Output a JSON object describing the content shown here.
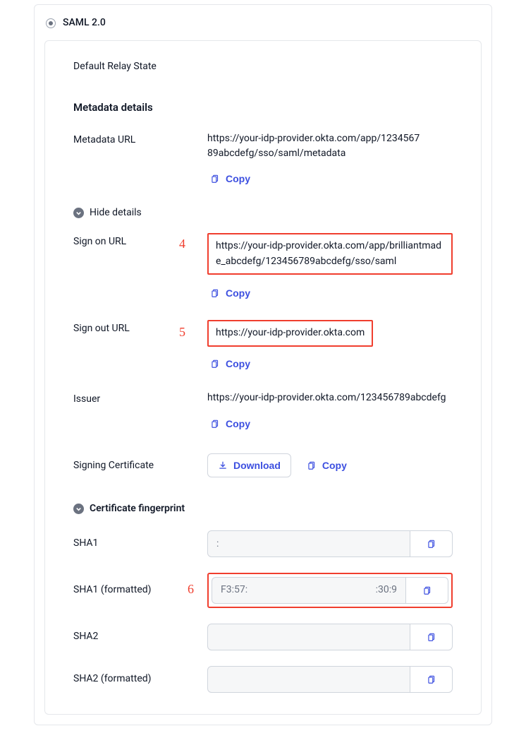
{
  "radio": {
    "label": "SAML 2.0"
  },
  "relay": {
    "label": "Default Relay State"
  },
  "headings": {
    "metadata": "Metadata details",
    "cert_fp": "Certificate fingerprint"
  },
  "fields": {
    "metadata_url": {
      "label": "Metadata URL",
      "value": "https://your-idp-provider.okta.com/app/123456789abcdefg/sso/saml/metadata"
    },
    "hide_details": "Hide details",
    "sign_on": {
      "label": "Sign on URL",
      "value": "https://your-idp-provider.okta.com/app/brilliantmade_abcdefg/123456789abcdefg/sso/saml"
    },
    "sign_out": {
      "label": "Sign out URL",
      "value": "https://your-idp-provider.okta.com"
    },
    "issuer": {
      "label": "Issuer",
      "value": "https://your-idp-provider.okta.com/123456789abcdefg"
    },
    "signing_cert": {
      "label": "Signing Certificate"
    }
  },
  "actions": {
    "copy": "Copy",
    "download": "Download"
  },
  "fingerprints": {
    "sha1": {
      "label": "SHA1",
      "value": ":"
    },
    "sha1f": {
      "label": "SHA1 (formatted)",
      "left": "F3:57:",
      "right": ":30:9"
    },
    "sha2": {
      "label": "SHA2",
      "value": ""
    },
    "sha2f": {
      "label": "SHA2 (formatted)",
      "value": ""
    }
  },
  "annotations": {
    "n4": "4",
    "n5": "5",
    "n6": "6"
  }
}
